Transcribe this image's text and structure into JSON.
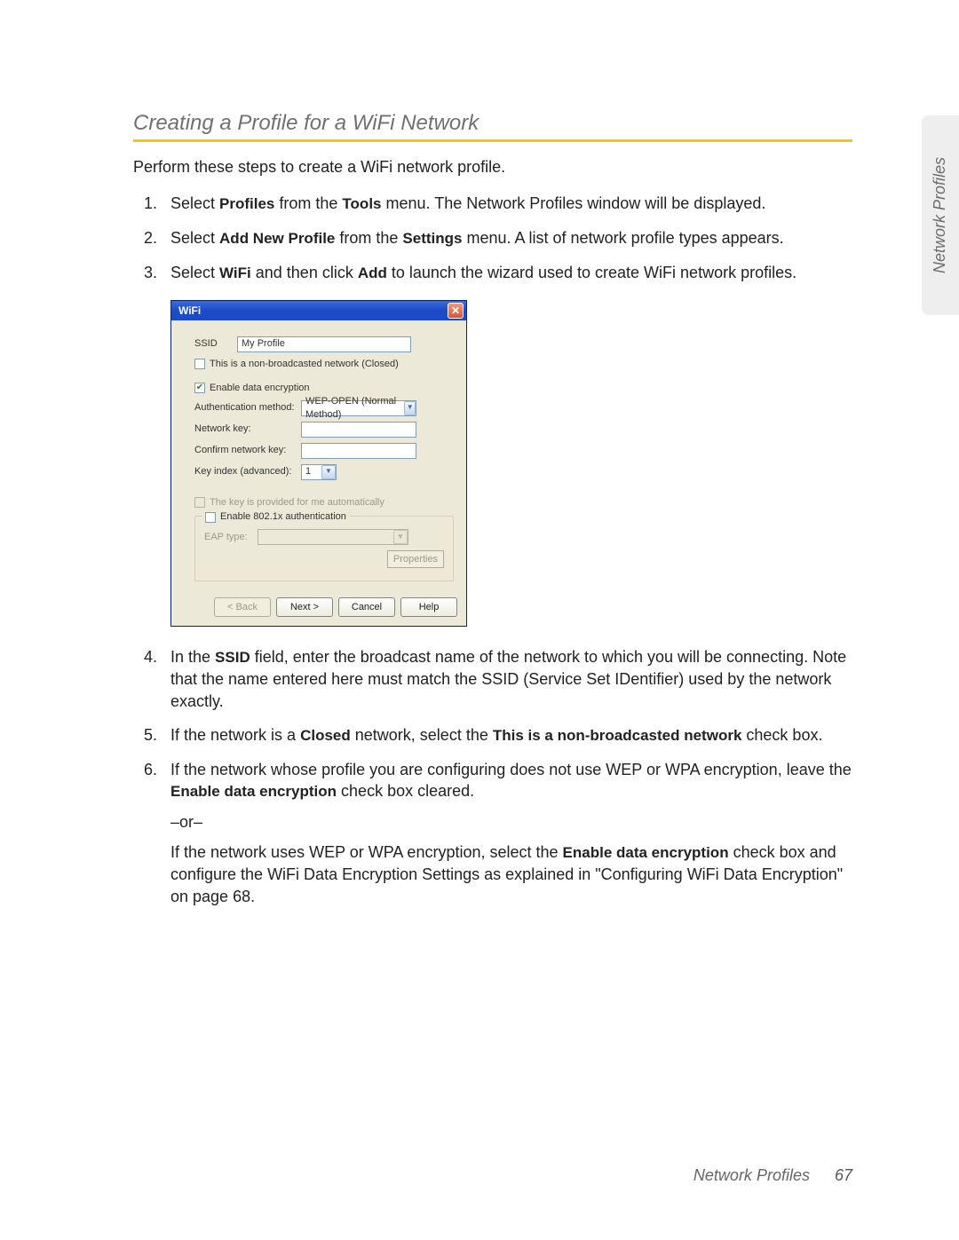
{
  "heading": "Creating a Profile for a WiFi Network",
  "intro": "Perform these steps to create a WiFi network profile.",
  "side_tab": "Network Profiles",
  "footer_section": "Network Profiles",
  "footer_page": "67",
  "step1": {
    "t1": "Select ",
    "b1": "Profiles",
    "t2": " from the ",
    "b2": "Tools",
    "t3": " menu. The Network Profiles window will be displayed."
  },
  "step2": {
    "t1": "Select ",
    "b1": "Add New Profile",
    "t2": " from the ",
    "b2": "Settings",
    "t3": " menu. A list of network profile types appears."
  },
  "step3": {
    "t1": "Select ",
    "b1": "WiFi",
    "t2": " and then click ",
    "b2": "Add",
    "t3": " to launch the wizard used to create WiFi network profiles."
  },
  "step4": {
    "t1": "In the ",
    "b1": "SSID",
    "t2": " field, enter the broadcast name of the network to which you will be connecting. Note that the name entered here must match the SSID (Service Set IDentifier) used by the network exactly."
  },
  "step5": {
    "t1": "If the network is a ",
    "b1": "Closed",
    "t2": " network, select the ",
    "b2": "This is a non-broadcasted network",
    "t3": " check box."
  },
  "step6": {
    "t1": "If the network whose profile you are configuring does not use WEP or WPA encryption, leave the ",
    "b1": "Enable data encryption",
    "t2": " check box cleared.",
    "or": "–or–",
    "t3": "If the network uses WEP or WPA encryption, select the ",
    "b2": "Enable data encryption",
    "t4": " check box and configure the WiFi Data Encryption Settings as explained in \"Configuring WiFi Data Encryption\" on page 68."
  },
  "dialog": {
    "title": "WiFi",
    "ssid_label": "SSID",
    "ssid_value": "My Profile",
    "closed_label": "This is a non-broadcasted network (Closed)",
    "enable_enc_label": "Enable data encryption",
    "auth_label": "Authentication method:",
    "auth_value": "WEP-OPEN (Normal Method)",
    "nk_label": "Network key:",
    "cnk_label": "Confirm network key:",
    "ki_label": "Key index (advanced):",
    "ki_value": "1",
    "auto_key_label": "The key is provided for me automatically",
    "group8021x_label": "Enable 802.1x authentication",
    "eap_label": "EAP type:",
    "props_label": "Properties",
    "back_label": "< Back",
    "next_label": "Next >",
    "cancel_label": "Cancel",
    "help_label": "Help"
  }
}
